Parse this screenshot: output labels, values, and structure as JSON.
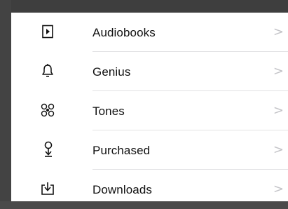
{
  "menu": {
    "items": [
      {
        "label": "Audiobooks",
        "icon": "audiobook-icon",
        "chevron": ">"
      },
      {
        "label": "Genius",
        "icon": "bell-icon",
        "chevron": ">"
      },
      {
        "label": "Tones",
        "icon": "tones-icon",
        "chevron": ">"
      },
      {
        "label": "Purchased",
        "icon": "purchased-icon",
        "chevron": ">"
      },
      {
        "label": "Downloads",
        "icon": "downloads-icon",
        "chevron": ">"
      }
    ]
  },
  "colors": {
    "background": "#4a4a4a",
    "panel": "#ffffff",
    "text": "#111111",
    "chevron": "#c4c4c8",
    "separator": "#e2e2e4"
  }
}
